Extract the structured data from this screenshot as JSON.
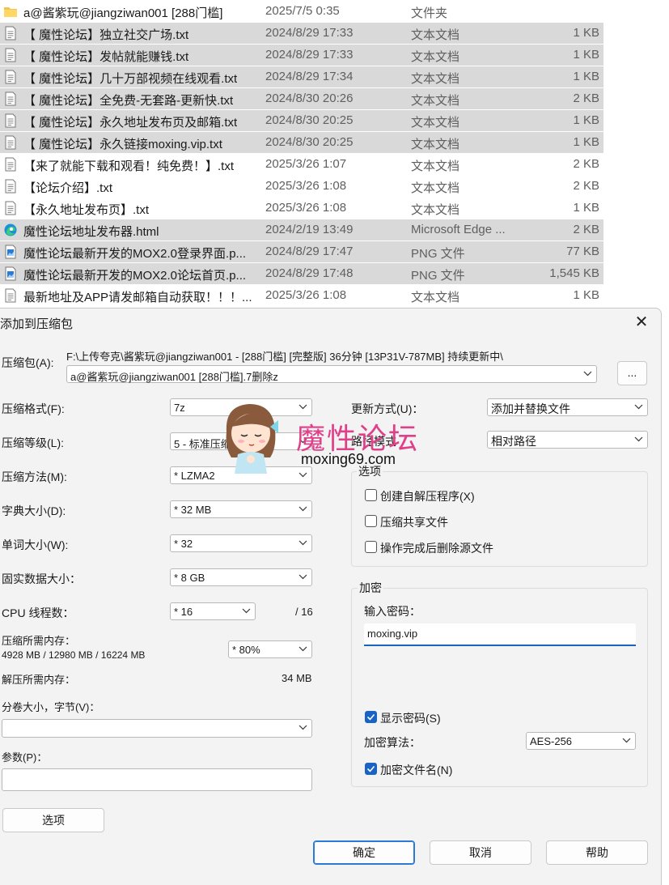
{
  "file_list": {
    "rows": [
      {
        "name": "a@酱紫玩@jiangziwan001 [288门槛]",
        "date": "2025/7/5 0:35",
        "type": "文件夹",
        "size": "",
        "icon": "folder-icon",
        "selected": false
      },
      {
        "name": "【 魔性论坛】独立社交广场.txt",
        "date": "2024/8/29 17:33",
        "type": "文本文档",
        "size": "1 KB",
        "icon": "text-file-icon",
        "selected": true
      },
      {
        "name": "【 魔性论坛】发帖就能赚钱.txt",
        "date": "2024/8/29 17:33",
        "type": "文本文档",
        "size": "1 KB",
        "icon": "text-file-icon",
        "selected": true
      },
      {
        "name": "【 魔性论坛】几十万部视频在线观看.txt",
        "date": "2024/8/29 17:34",
        "type": "文本文档",
        "size": "1 KB",
        "icon": "text-file-icon",
        "selected": true
      },
      {
        "name": "【 魔性论坛】全免费-无套路-更新快.txt",
        "date": "2024/8/30 20:26",
        "type": "文本文档",
        "size": "2 KB",
        "icon": "text-file-icon",
        "selected": true
      },
      {
        "name": "【 魔性论坛】永久地址发布页及邮箱.txt",
        "date": "2024/8/30 20:25",
        "type": "文本文档",
        "size": "1 KB",
        "icon": "text-file-icon",
        "selected": true
      },
      {
        "name": "【 魔性论坛】永久链接moxing.vip.txt",
        "date": "2024/8/30 20:25",
        "type": "文本文档",
        "size": "1 KB",
        "icon": "text-file-icon",
        "selected": true
      },
      {
        "name": "【来了就能下载和观看！纯免费！】.txt",
        "date": "2025/3/26 1:07",
        "type": "文本文档",
        "size": "2 KB",
        "icon": "text-file-icon",
        "selected": false
      },
      {
        "name": "【论坛介绍】.txt",
        "date": "2025/3/26 1:08",
        "type": "文本文档",
        "size": "2 KB",
        "icon": "text-file-icon",
        "selected": false
      },
      {
        "name": "【永久地址发布页】.txt",
        "date": "2025/3/26 1:08",
        "type": "文本文档",
        "size": "1 KB",
        "icon": "text-file-icon",
        "selected": false
      },
      {
        "name": "魔性论坛地址发布器.html",
        "date": "2024/2/19 13:49",
        "type": "Microsoft Edge ...",
        "size": "2 KB",
        "icon": "edge-icon",
        "selected": true
      },
      {
        "name": "魔性论坛最新开发的MOX2.0登录界面.p...",
        "date": "2024/8/29 17:47",
        "type": "PNG 文件",
        "size": "77 KB",
        "icon": "image-file-icon",
        "selected": true
      },
      {
        "name": "魔性论坛最新开发的MOX2.0论坛首页.p...",
        "date": "2024/8/29 17:48",
        "type": "PNG 文件",
        "size": "1,545 KB",
        "icon": "image-file-icon",
        "selected": true
      },
      {
        "name": "最新地址及APP请发邮箱自动获取！！！...",
        "date": "2025/3/26 1:08",
        "type": "文本文档",
        "size": "1 KB",
        "icon": "text-file-icon",
        "selected": false
      }
    ]
  },
  "dialog": {
    "title": "添加到压缩包",
    "close": "✕",
    "archive_label": "压缩包(A):",
    "archive_path": "F:\\上传夸克\\酱紫玩@jiangziwan001 - [288门槛] [完整版] 36分钟 [13P31V-787MB] 持续更新中\\",
    "archive_name": "a@酱紫玩@jiangziwan001 [288门槛].7删除z",
    "browse_label": "...",
    "format_label": "压缩格式(F):",
    "format_value": "7z",
    "level_label": "压缩等级(L):",
    "level_value": "5 - 标准压缩",
    "method_label": "压缩方法(M):",
    "method_value": "* LZMA2",
    "dict_label": "字典大小(D):",
    "dict_value": "* 32 MB",
    "word_label": "单词大小(W):",
    "word_value": "* 32",
    "solid_label": "固实数据大小：",
    "solid_value": "* 8 GB",
    "cpu_label": "CPU 线程数：",
    "cpu_value": "* 16",
    "cpu_max": "/ 16",
    "mem_label": "压缩所需内存：",
    "mem_detail": "4928 MB / 12980 MB / 16224 MB",
    "mem_value": "* 80%",
    "decomp_label": "解压所需内存：",
    "decomp_value": "34 MB",
    "split_label": "分卷大小，字节(V)：",
    "split_value": "",
    "params_label": "参数(P)：",
    "params_value": "",
    "options_button": "选项",
    "update_label": "更新方式(U)：",
    "update_value": "添加并替换文件",
    "path_label": "路径模式",
    "path_value": "相对路径",
    "options_group": "选项",
    "opt_sfx": "创建自解压程序(X)",
    "opt_sfx_checked": false,
    "opt_shared": "压缩共享文件",
    "opt_shared_checked": false,
    "opt_delete": "操作完成后删除源文件",
    "opt_delete_checked": false,
    "encrypt_group": "加密",
    "password_label": "输入密码：",
    "password_value": "moxing.vip",
    "show_password": "显示密码(S)",
    "show_password_checked": true,
    "algo_label": "加密算法：",
    "algo_value": "AES-256",
    "encrypt_names": "加密文件名(N)",
    "encrypt_names_checked": true,
    "ok": "确定",
    "cancel": "取消",
    "help": "帮助"
  },
  "watermark": {
    "title": "魔性论坛",
    "url": "moxing69.com"
  },
  "colors": {
    "selection": "#d9d9d9",
    "accent": "#1a63c4",
    "watermark": "#e0408a"
  }
}
